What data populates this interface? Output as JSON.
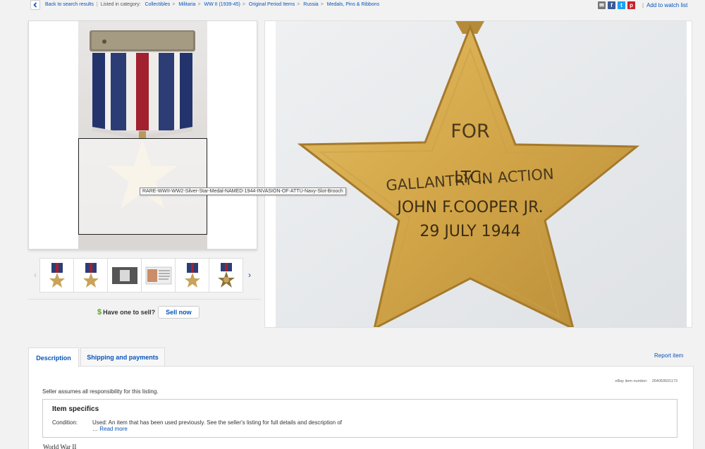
{
  "topbar": {
    "back_label": "Back to search results",
    "listed_in": "Listed in category:",
    "categories": [
      "Collectibles",
      "Militaria",
      "WW II (1939-45)",
      "Original Period Items",
      "Russia",
      "Medals, Pins & Ribbons"
    ],
    "watch_label": "Add to watch list"
  },
  "gallery": {
    "tooltip": "RARE-WWII-WW2-Silver-Star-Medal-NAMED-1944-INVASION-OF-ATTU-Navy-Slot-Brooch",
    "thumb_count": 6
  },
  "medal_engraving": {
    "line1": "FOR",
    "line2": "GALLANTRY IN ACTION",
    "line3": "LTC.",
    "line4": "JOHN F.COOPER JR.",
    "line5": "29 JULY 1944"
  },
  "sell": {
    "question": "Have one to sell?",
    "button": "Sell now"
  },
  "tabs": {
    "description": "Description",
    "shipping": "Shipping and payments",
    "report": "Report item"
  },
  "description": {
    "item_number_label": "eBay item number:",
    "item_number": "264059501173",
    "assumes": "Seller assumes all responsibility for this listing.",
    "specifics_title": "Item specifics",
    "condition_label": "Condition:",
    "condition_value": "Used: An item that has been used previously. See the seller's listing for full details and description of",
    "read_more": "Read more",
    "body_start": "World War II"
  },
  "colors": {
    "link": "#0654ba",
    "medal_gold": "#d4a94a",
    "sell_dollar": "#5ba71b"
  }
}
